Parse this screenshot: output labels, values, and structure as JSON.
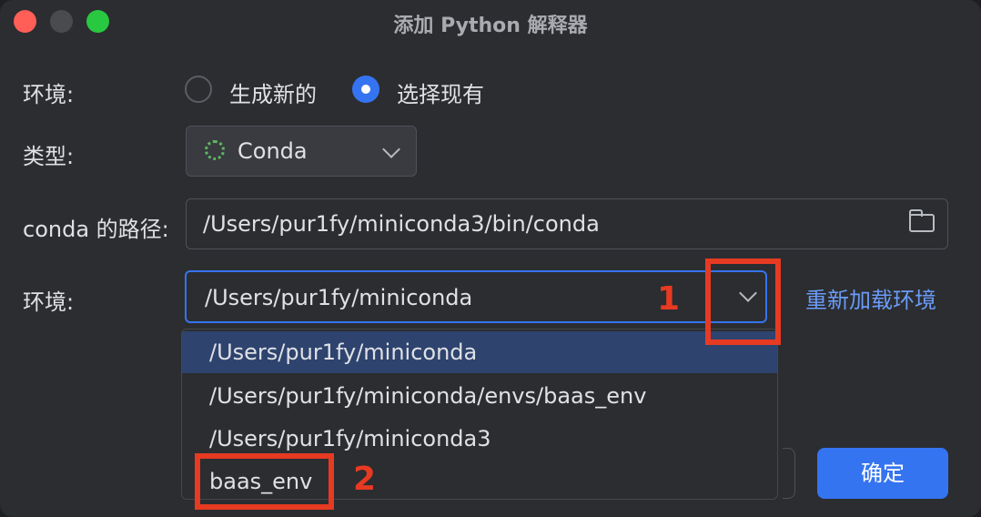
{
  "window": {
    "title": "添加 Python 解释器"
  },
  "environment_mode": {
    "label": "环境:",
    "options": [
      {
        "label": "生成新的",
        "selected": false
      },
      {
        "label": "选择现有",
        "selected": true
      }
    ]
  },
  "type": {
    "label": "类型:",
    "value": "Conda",
    "icon": "conda-icon"
  },
  "conda_path": {
    "label": "conda 的路径:",
    "value": "/Users/pur1fy/miniconda3/bin/conda",
    "icon": "folder-icon"
  },
  "env": {
    "label": "环境:",
    "value": "/Users/pur1fy/miniconda",
    "reload_label": "重新加载环境",
    "dropdown_items": [
      "/Users/pur1fy/miniconda",
      "/Users/pur1fy/miniconda/envs/baas_env",
      "/Users/pur1fy/miniconda3",
      "baas_env"
    ],
    "selected_index": 0
  },
  "buttons": {
    "ok_label": "确定"
  },
  "annotations": {
    "marker_1": "1",
    "marker_2": "2",
    "color": "#e73a22"
  },
  "colors": {
    "accent": "#3574f0",
    "link": "#6b9bf7",
    "selection": "#2e436e"
  }
}
